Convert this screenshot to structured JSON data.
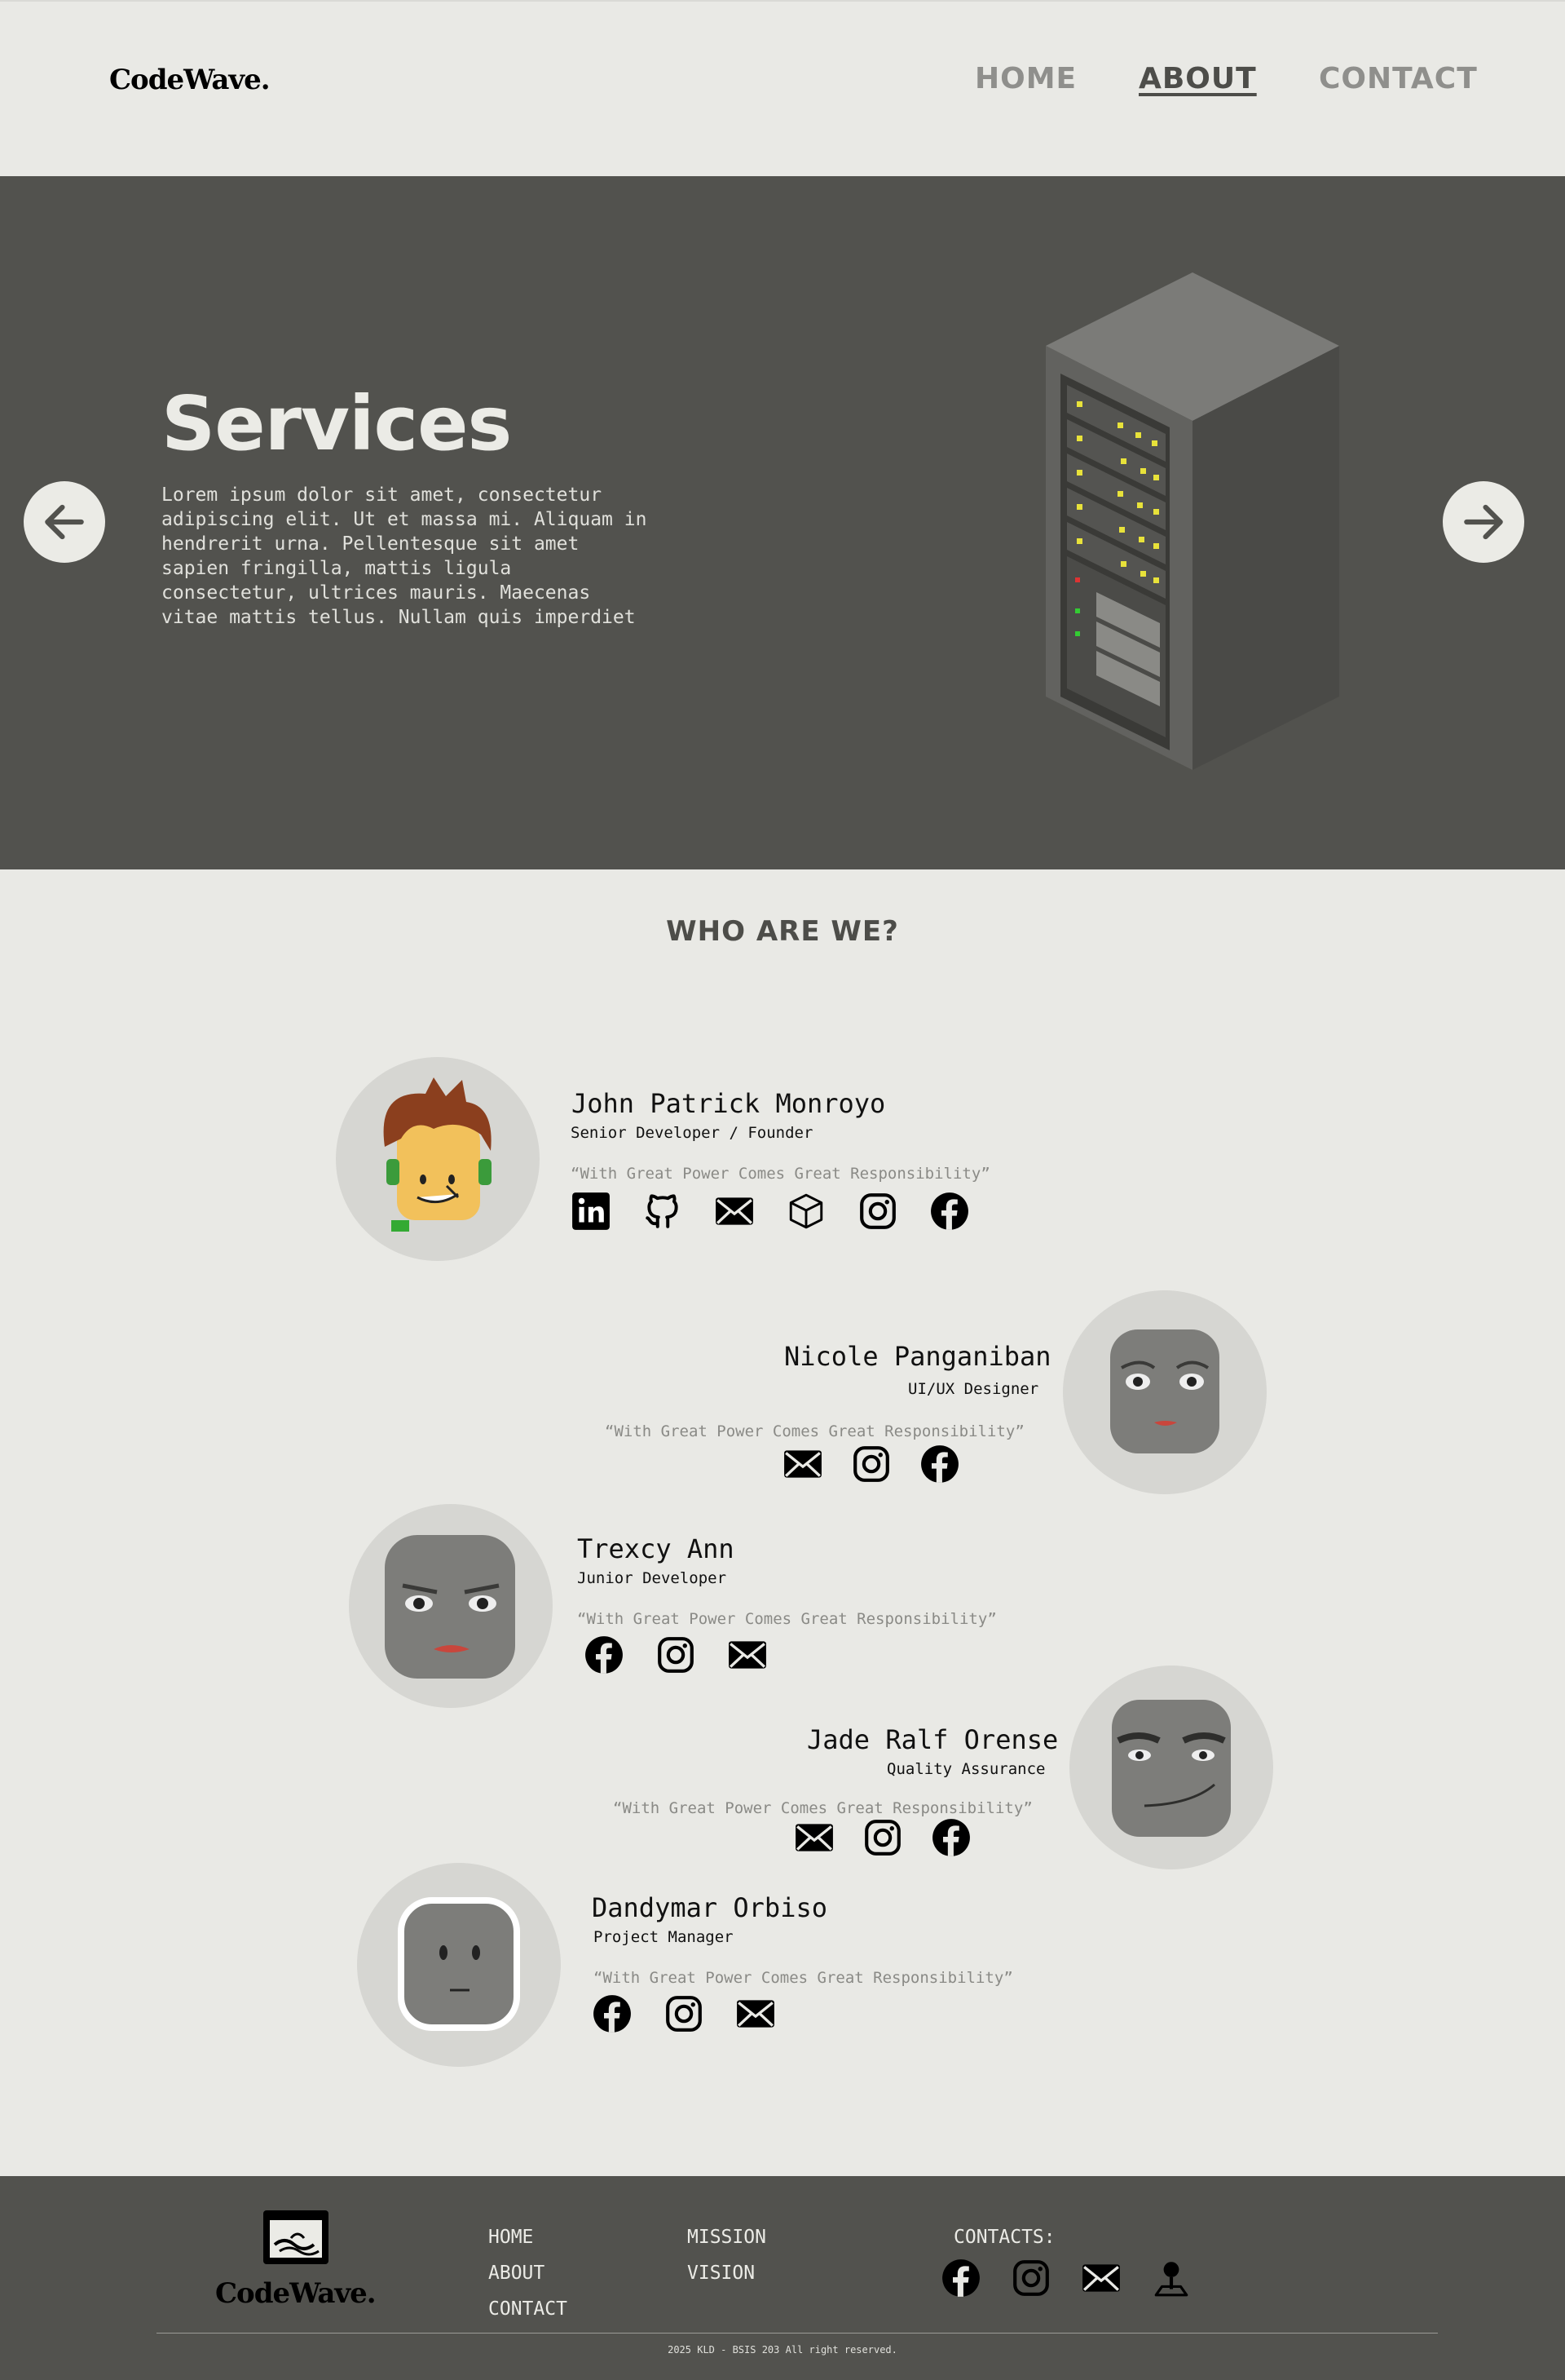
{
  "header": {
    "logo": "CodeWave.",
    "nav": [
      {
        "label": "HOME"
      },
      {
        "label": "ABOUT"
      },
      {
        "label": "CONTACT"
      }
    ]
  },
  "hero": {
    "title": "Services",
    "text": "Lorem ipsum dolor sit amet, consectetur adipiscing elit. Ut et massa mi. Aliquam in hendrerit urna. Pellentesque sit amet sapien fringilla, mattis ligula consectetur, ultrices mauris. Maecenas vitae mattis tellus. Nullam quis imperdiet",
    "prev_icon": "arrow-left-icon",
    "next_icon": "arrow-right-icon"
  },
  "who": {
    "title": "WHO ARE WE?",
    "members": [
      {
        "name": "John Patrick Monroyo",
        "role": "Senior Developer / Founder",
        "quote": "“With Great Power Comes Great Responsibility”",
        "icons": [
          "linkedin-icon",
          "github-icon",
          "mail-icon",
          "box-icon",
          "instagram-icon",
          "facebook-icon"
        ]
      },
      {
        "name": "Nicole Panganiban",
        "role": "UI/UX Designer",
        "quote": "“With Great Power Comes Great Responsibility”",
        "icons": [
          "mail-icon",
          "instagram-icon",
          "facebook-icon"
        ]
      },
      {
        "name": "Trexcy Ann",
        "role": "Junior Developer",
        "quote": "“With Great Power Comes Great Responsibility”",
        "icons": [
          "facebook-icon",
          "instagram-icon",
          "mail-icon"
        ]
      },
      {
        "name": "Jade Ralf Orense",
        "role": "Quality Assurance",
        "quote": "“With Great Power Comes Great Responsibility”",
        "icons": [
          "mail-icon",
          "instagram-icon",
          "facebook-icon"
        ]
      },
      {
        "name": "Dandymar Orbiso",
        "role": "Project Manager",
        "quote": "“With Great Power Comes Great Responsibility”",
        "icons": [
          "facebook-icon",
          "instagram-icon",
          "mail-icon"
        ]
      }
    ]
  },
  "footer": {
    "logo": "CodeWave.",
    "links_col1": [
      "HOME",
      "ABOUT",
      "CONTACT"
    ],
    "links_col2": [
      "MISSION",
      "VISION"
    ],
    "contacts_label": "CONTACTS:",
    "contact_icons": [
      "facebook-icon",
      "instagram-icon",
      "mail-icon",
      "map-pin-icon"
    ],
    "copyright": "2025 KLD - BSIS 203 All right reserved."
  },
  "colors": {
    "background": "#e9e9e5",
    "hero": "#52524e",
    "avatar_bg": "#d6d6d2",
    "muted_text": "#8a8a86"
  }
}
